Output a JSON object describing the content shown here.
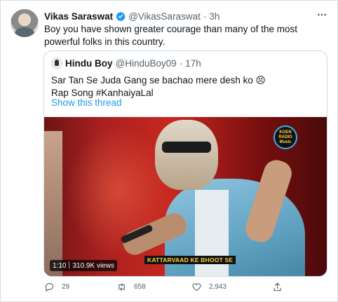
{
  "tweet": {
    "author_name": "Vikas Saraswat",
    "handle": "@VikasSaraswat",
    "separator": "·",
    "time": "3h",
    "text": "Boy you have shown greater courage than many of the most powerful folks in this country.",
    "more_icon": "more-icon"
  },
  "quoted_tweet": {
    "author_name": "Hindu Boy",
    "handle": "@HinduBoy09",
    "separator": "·",
    "time": "17h",
    "line1": "Sar Tan Se Juda Gang se bachao mere desh ko 😣",
    "line2": "Rap Song #KanhaiyaLal",
    "show_thread": "Show this thread",
    "video": {
      "duration": "1:10",
      "views": "310.9K views",
      "subtitle": "KATTARVAAD KE BHOOT SE",
      "logo_text": [
        "KOEN",
        "RADIO",
        "Music"
      ]
    }
  },
  "actions": {
    "reply_count": "29",
    "retweet_count": "658",
    "like_count": "2,943"
  },
  "colors": {
    "link": "#1d9bf0",
    "verified": "#1d9bf0",
    "muted": "#536471"
  }
}
